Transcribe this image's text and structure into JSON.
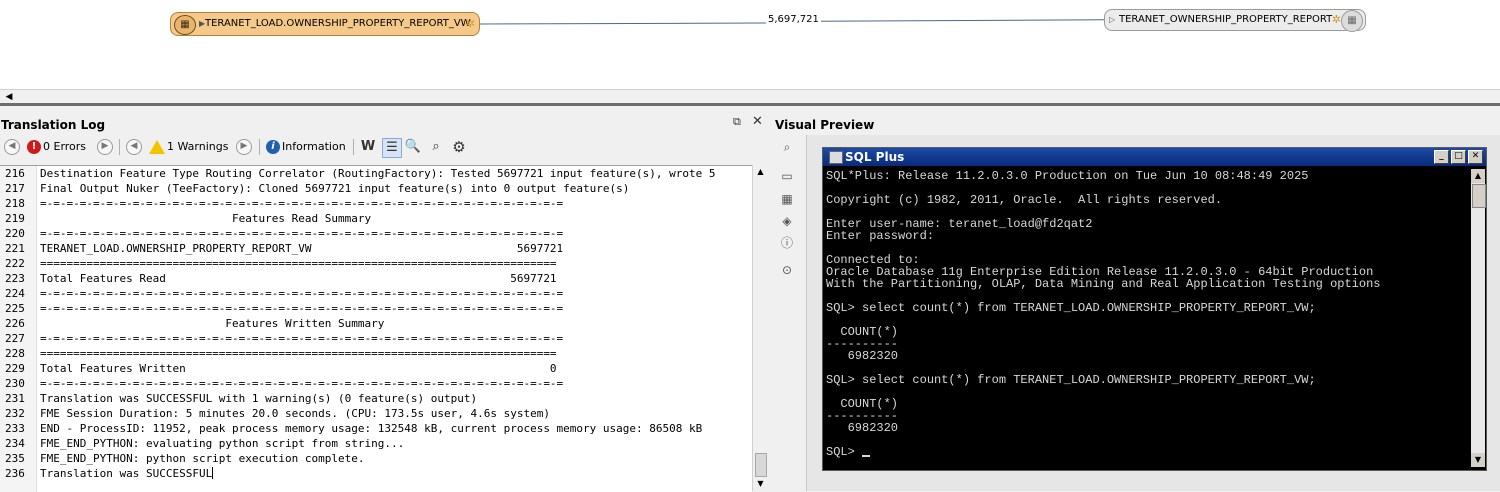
{
  "workspace": {
    "reader_label": "TERANET_LOAD.OWNERSHIP_PROPERTY_REPORT_VW",
    "writer_label": "TERANET_OWNERSHIP_PROPERTY_REPORT",
    "feature_count": "5,697,721"
  },
  "translation_log": {
    "title": "Translation Log",
    "errors_label": "0 Errors",
    "warnings_label": "1 Warnings",
    "information_label": "Information",
    "lines": [
      {
        "num": "216",
        "text": "Destination Feature Type Routing Correlator (RoutingFactory): Tested 5697721 input feature(s), wrote 5"
      },
      {
        "num": "217",
        "text": "Final Output Nuker (TeeFactory): Cloned 5697721 input feature(s) into 0 output feature(s)"
      },
      {
        "num": "218",
        "text": "=-=-=-=-=-=-=-=-=-=-=-=-=-=-=-=-=-=-=-=-=-=-=-=-=-=-=-=-=-=-=-=-=-=-=-=-=-=-=-="
      },
      {
        "num": "219",
        "text": "                             Features Read Summary"
      },
      {
        "num": "220",
        "text": "=-=-=-=-=-=-=-=-=-=-=-=-=-=-=-=-=-=-=-=-=-=-=-=-=-=-=-=-=-=-=-=-=-=-=-=-=-=-=-="
      },
      {
        "num": "221",
        "text": "TERANET_LOAD.OWNERSHIP_PROPERTY_REPORT_VW                               5697721"
      },
      {
        "num": "222",
        "text": "=============================================================================="
      },
      {
        "num": "223",
        "text": "Total Features Read                                                    5697721"
      },
      {
        "num": "224",
        "text": "=-=-=-=-=-=-=-=-=-=-=-=-=-=-=-=-=-=-=-=-=-=-=-=-=-=-=-=-=-=-=-=-=-=-=-=-=-=-=-="
      },
      {
        "num": "225",
        "text": "=-=-=-=-=-=-=-=-=-=-=-=-=-=-=-=-=-=-=-=-=-=-=-=-=-=-=-=-=-=-=-=-=-=-=-=-=-=-=-="
      },
      {
        "num": "226",
        "text": "                            Features Written Summary"
      },
      {
        "num": "227",
        "text": "=-=-=-=-=-=-=-=-=-=-=-=-=-=-=-=-=-=-=-=-=-=-=-=-=-=-=-=-=-=-=-=-=-=-=-=-=-=-=-="
      },
      {
        "num": "228",
        "text": "=============================================================================="
      },
      {
        "num": "229",
        "text": "Total Features Written                                                       0"
      },
      {
        "num": "230",
        "text": "=-=-=-=-=-=-=-=-=-=-=-=-=-=-=-=-=-=-=-=-=-=-=-=-=-=-=-=-=-=-=-=-=-=-=-=-=-=-=-="
      },
      {
        "num": "231",
        "text": "Translation was SUCCESSFUL with 1 warning(s) (0 feature(s) output)"
      },
      {
        "num": "232",
        "text": "FME Session Duration: 5 minutes 20.0 seconds. (CPU: 173.5s user, 4.6s system)"
      },
      {
        "num": "233",
        "text": "END - ProcessID: 11952, peak process memory usage: 132548 kB, current process memory usage: 86508 kB"
      },
      {
        "num": "234",
        "text": "FME_END_PYTHON: evaluating python script from string..."
      },
      {
        "num": "235",
        "text": "FME_END_PYTHON: python script execution complete."
      },
      {
        "num": "236",
        "text": "Translation was SUCCESSFUL"
      }
    ]
  },
  "visual_preview": {
    "title": "Visual Preview",
    "sql_window_title": "SQL Plus",
    "console_lines": [
      "SQL*Plus: Release 11.2.0.3.0 Production on Tue Jun 10 08:48:49 2025",
      "",
      "Copyright (c) 1982, 2011, Oracle.  All rights reserved.",
      "",
      "Enter user-name: teranet_load@fd2qat2",
      "Enter password:",
      "",
      "Connected to:",
      "Oracle Database 11g Enterprise Edition Release 11.2.0.3.0 - 64bit Production",
      "With the Partitioning, OLAP, Data Mining and Real Application Testing options",
      "",
      "SQL> select count(*) from TERANET_LOAD.OWNERSHIP_PROPERTY_REPORT_VW;",
      "",
      "  COUNT(*)",
      "----------",
      "   6982320",
      "",
      "SQL> select count(*) from TERANET_LOAD.OWNERSHIP_PROPERTY_REPORT_VW;",
      "",
      "  COUNT(*)",
      "----------",
      "   6982320",
      "",
      "SQL> "
    ]
  },
  "colors": {
    "reader_node": "#f5c98a",
    "console_bg": "#000000",
    "console_text": "#d8d8d8",
    "titlebar": "#0a2a7a"
  }
}
